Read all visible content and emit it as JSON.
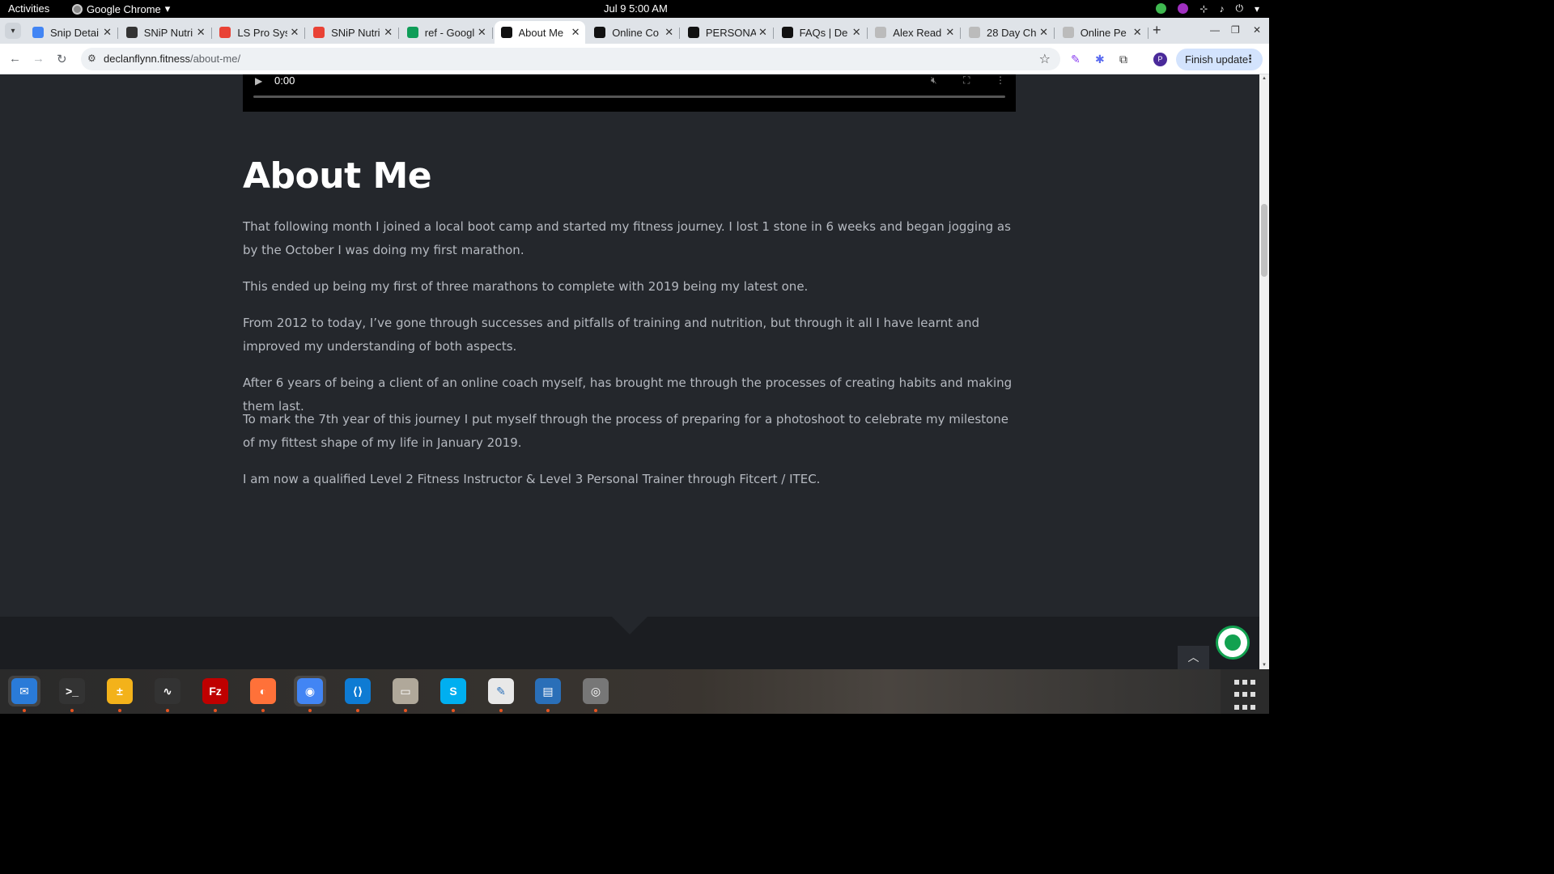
{
  "topbar": {
    "activities": "Activities",
    "app_name": "Google Chrome",
    "clock": "Jul 9  5:00 AM"
  },
  "tabs": [
    {
      "title": "Snip Detai",
      "favicon_color": "#4285f4"
    },
    {
      "title": "SNiP Nutri",
      "favicon_color": "#333333"
    },
    {
      "title": "LS Pro Sys",
      "favicon_color": "#e94235"
    },
    {
      "title": "SNiP Nutri",
      "favicon_color": "#e94235"
    },
    {
      "title": "ref - Googl",
      "favicon_color": "#0f9d58"
    },
    {
      "title": "About Me",
      "favicon_color": "#111111",
      "active": true
    },
    {
      "title": "Online Co",
      "favicon_color": "#111111"
    },
    {
      "title": "PERSONA",
      "favicon_color": "#111111"
    },
    {
      "title": "FAQs | De",
      "favicon_color": "#111111"
    },
    {
      "title": "Alex Read",
      "favicon_color": "#bbbbbb"
    },
    {
      "title": "28 Day Ch",
      "favicon_color": "#bbbbbb"
    },
    {
      "title": "Online Pe",
      "favicon_color": "#bbbbbb"
    }
  ],
  "toolbar": {
    "url_host": "declanflynn.fitness",
    "url_path": "/about-me/",
    "finish_update": "Finish update",
    "avatar_letter": "P"
  },
  "video": {
    "time": "0:00"
  },
  "page": {
    "heading": "About Me",
    "paragraphs": [
      "That following month I joined a local boot camp and started my fitness journey. I lost 1 stone in 6 weeks and began jogging as by the October I was doing my first marathon.",
      "This ended up being my first of three marathons to complete with 2019 being my latest one.",
      "From 2012 to today, I’ve gone through successes and pitfalls of training and nutrition, but through it all I have learnt and improved my understanding of both aspects.",
      "After 6 years of being a client of an online coach myself, has brought me through the processes of creating habits and making them last.",
      "To mark the 7th year of this journey I put myself through the process of preparing for a photoshoot to celebrate my milestone of my fittest shape of my life in January 2019.",
      "I am now a qualified Level 2 Fitness Instructor & Level 3 Personal Trainer through Fitcert / ITEC."
    ]
  },
  "dock": [
    {
      "name": "thunderbird-icon",
      "color": "#2a7bd8"
    },
    {
      "name": "terminal-icon",
      "color": "#333333"
    },
    {
      "name": "calculator-icon",
      "color": "#f3b21a"
    },
    {
      "name": "system-monitor-icon",
      "color": "#333333"
    },
    {
      "name": "filezilla-icon",
      "color": "#bf0000"
    },
    {
      "name": "firefox-icon",
      "color": "#ff7139"
    },
    {
      "name": "chrome-icon",
      "color": "#4285f4"
    },
    {
      "name": "vscode-icon",
      "color": "#0e7bd3"
    },
    {
      "name": "files-icon",
      "color": "#b0a89a"
    },
    {
      "name": "skype-icon",
      "color": "#00aff0"
    },
    {
      "name": "text-editor-icon",
      "color": "#e8e8e8"
    },
    {
      "name": "writer-icon",
      "color": "#2a6fb8"
    },
    {
      "name": "disk-icon",
      "color": "#777777"
    }
  ]
}
